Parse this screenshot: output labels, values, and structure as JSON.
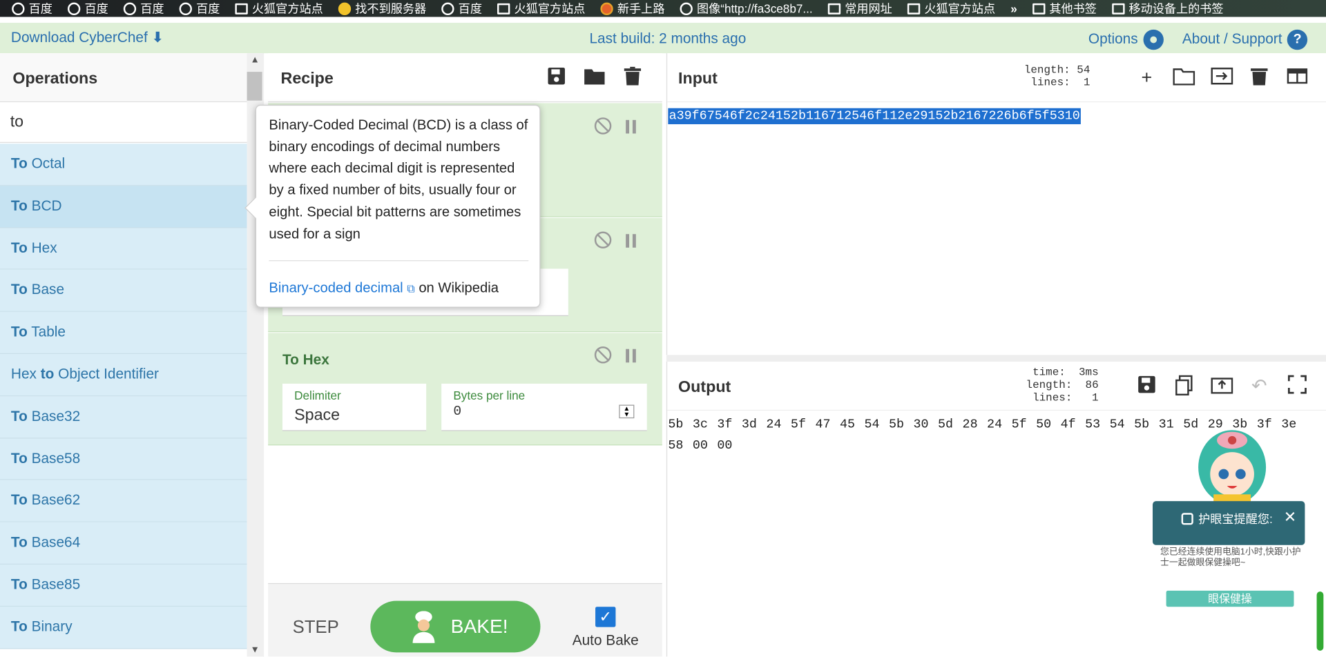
{
  "bookmarks": [
    {
      "label": "百度",
      "icon": "globe-icon"
    },
    {
      "label": "百度",
      "icon": "globe-icon"
    },
    {
      "label": "百度",
      "icon": "globe-icon"
    },
    {
      "label": "百度",
      "icon": "globe-icon"
    },
    {
      "label": "火狐官方站点",
      "icon": "folder-icon"
    },
    {
      "label": "找不到服务器",
      "icon": "plus-icon"
    },
    {
      "label": "百度",
      "icon": "baidu-icon"
    },
    {
      "label": "火狐官方站点",
      "icon": "folder-icon"
    },
    {
      "label": "新手上路",
      "icon": "firefox-icon"
    },
    {
      "label": "图像“http://fa3ce8b7...",
      "icon": "globe-icon"
    },
    {
      "label": "常用网址",
      "icon": "folder-icon"
    },
    {
      "label": "火狐官方站点",
      "icon": "folder-icon"
    }
  ],
  "bookmarks_more": "»",
  "bookmarks_right": [
    "其他书签",
    "移动设备上的书签"
  ],
  "banner": {
    "download": "Download CyberChef",
    "last_build": "Last build: 2 months ago",
    "options": "Options",
    "about": "About / Support"
  },
  "operations": {
    "title": "Operations",
    "search_value": "to",
    "items": [
      "To Octal",
      "To BCD",
      "To Hex",
      "To Base",
      "To Table",
      "Hex to Object Identifier",
      "To Base32",
      "To Base58",
      "To Base62",
      "To Base64",
      "To Base85",
      "To Binary"
    ]
  },
  "recipe": {
    "title": "Recipe",
    "to_hex": {
      "name": "To Hex",
      "delimiter_label": "Delimiter",
      "delimiter_value": "Space",
      "bytes_label": "Bytes per line",
      "bytes_value": "0"
    },
    "step_label": "STEP",
    "bake_label": "BAKE!",
    "autobake_label": "Auto Bake",
    "autobake_checked": true
  },
  "tooltip": {
    "description": "Binary-Coded Decimal (BCD) is a class of binary encodings of decimal numbers where each decimal digit is represented by a fixed number of bits, usually four or eight. Special bit patterns are sometimes used for a sign",
    "link_text": "Binary-coded decimal",
    "link_suffix": "on Wikipedia"
  },
  "input": {
    "title": "Input",
    "length_label": "length:",
    "length": "54",
    "lines_label": "lines:",
    "lines": "1",
    "text": "a39f67546f2c24152b116712546f112e29152b2167226b6f5f5310"
  },
  "output": {
    "title": "Output",
    "time_label": "time:",
    "time": "3ms",
    "length_label": "length:",
    "length": "86",
    "lines_label": "lines:",
    "lines": "1",
    "text": "5b 3c 3f 3d 24 5f 47 45 54 5b 30 5d 28 24 5f 50 4f 53 54 5b 31 5d 29 3b 3f 3e 58 00 00"
  },
  "eye_popup": {
    "title": "护眼宝提醒您:",
    "message": "您已经连续使用电脑1小时,快跟小护士一起做眼保健操吧~",
    "button": "眼保健操",
    "close": "✕"
  },
  "colors": {
    "banner_bg": "#dff0d8",
    "link": "#2a6fae",
    "op_bg": "#d9edf7",
    "recipe_card": "#dff0d8",
    "bake": "#5cb85c",
    "selection": "#1e6fd0"
  }
}
